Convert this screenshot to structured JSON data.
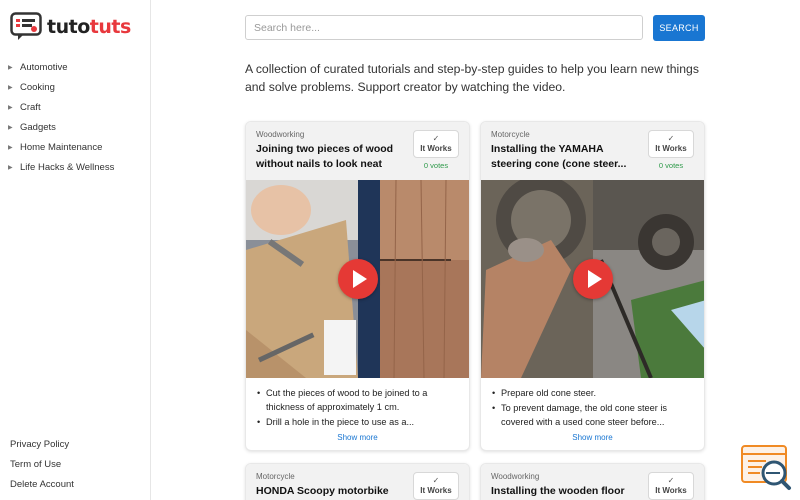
{
  "brand": {
    "name_part1": "tuto",
    "name_part2": "tuts"
  },
  "sidebar": {
    "categories": [
      {
        "label": "Automotive"
      },
      {
        "label": "Cooking"
      },
      {
        "label": "Craft"
      },
      {
        "label": "Gadgets"
      },
      {
        "label": "Home Maintenance"
      },
      {
        "label": "Life Hacks & Wellness"
      }
    ],
    "footer": [
      {
        "label": "Privacy Policy"
      },
      {
        "label": "Term of Use"
      },
      {
        "label": "Delete Account"
      }
    ]
  },
  "search": {
    "placeholder": "Search here...",
    "button_label": "SEARCH"
  },
  "intro": "A collection of curated tutorials and step-by-step guides to help you learn new things and solve problems. Support creator by watching the video.",
  "cards": [
    {
      "category": "Woodworking",
      "title_line1": "Joining two pieces of wood",
      "title_line2": "without nails to look neat",
      "works_check": "✓",
      "works_label": "It Works",
      "votes": "0 votes",
      "bullets": [
        "Cut the pieces of wood to be joined to a thickness of approximately 1 cm.",
        "Drill a hole in the piece to use as a..."
      ],
      "more": "Show more"
    },
    {
      "category": "Motorcycle",
      "title_line1": "Installing the YAMAHA",
      "title_line2": "steering cone (cone steer...",
      "works_check": "✓",
      "works_label": "It Works",
      "votes": "0 votes",
      "bullets": [
        "Prepare old cone steer.",
        "To prevent damage, the old cone steer is covered with a used cone steer before..."
      ],
      "more": "Show more"
    },
    {
      "category": "Motorcycle",
      "title_line1": "HONDA Scoopy motorbike",
      "works_check": "✓",
      "works_label": "It Works"
    },
    {
      "category": "Woodworking",
      "title_line1": "Installing the wooden floor",
      "works_check": "✓",
      "works_label": "It Works"
    }
  ],
  "colors": {
    "accent": "#1976d2",
    "brand_red": "#e8383d",
    "votes_green": "#2e9a4a",
    "play_red": "#e53935"
  }
}
